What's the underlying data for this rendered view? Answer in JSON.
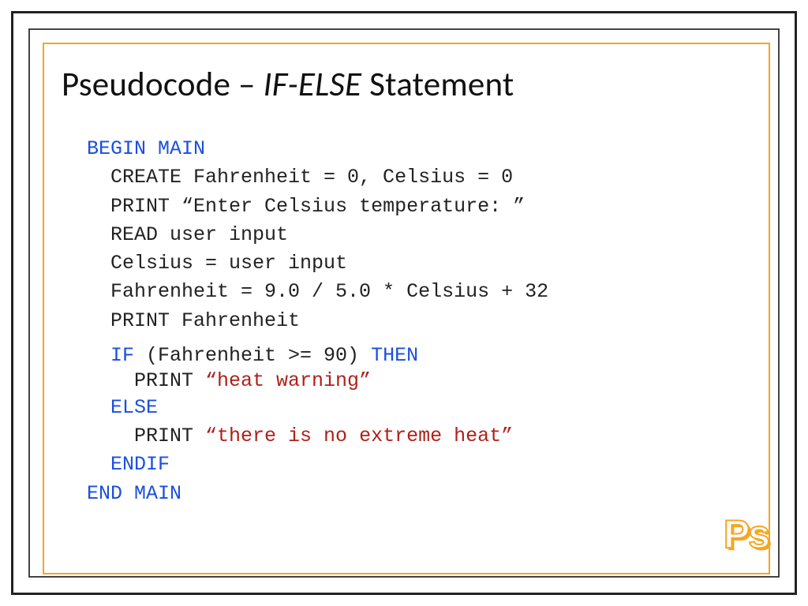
{
  "title": {
    "prefix": "Pseudocode – ",
    "italic": "IF-ELSE",
    "suffix": " Statement"
  },
  "code": {
    "begin": "BEGIN MAIN",
    "l1": "  CREATE Fahrenheit = 0, Celsius = 0",
    "l2_a": "  PRINT ",
    "l2_b": "“Enter Celsius temperature: ”",
    "l3": "  READ user input",
    "l4": "  Celsius = user input",
    "l5": "  Fahrenheit = 9.0 / 5.0 * Celsius + 32",
    "l6": "  PRINT Fahrenheit",
    "l7_if": "  IF",
    "l7_cond": " (Fahrenheit >= 90) ",
    "l7_then": "THEN",
    "l8_a": "    PRINT ",
    "l8_b": "“heat warning”",
    "l9": "  ELSE",
    "l10_a": "    PRINT ",
    "l10_b": "“there is no extreme heat”",
    "l11": "  ENDIF",
    "end": "END MAIN"
  },
  "logo": "Ps"
}
